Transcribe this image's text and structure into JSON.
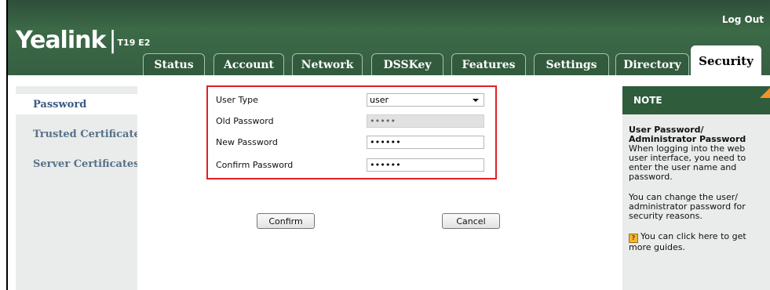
{
  "header": {
    "brand": "Yealink",
    "model": "T19 E2",
    "logout_label": "Log Out"
  },
  "tabs": [
    {
      "label": "Status"
    },
    {
      "label": "Account"
    },
    {
      "label": "Network"
    },
    {
      "label": "DSSKey"
    },
    {
      "label": "Features"
    },
    {
      "label": "Settings"
    },
    {
      "label": "Directory"
    },
    {
      "label": "Security",
      "active": true
    }
  ],
  "sidebar": {
    "items": [
      {
        "label": "Password",
        "active": true
      },
      {
        "label": "Trusted Certificates"
      },
      {
        "label": "Server Certificates"
      }
    ]
  },
  "form": {
    "user_type": {
      "label": "User Type",
      "value": "user"
    },
    "old_password": {
      "label": "Old Password",
      "value": "•••••"
    },
    "new_password": {
      "label": "New Password",
      "value": "••••••"
    },
    "confirm_password": {
      "label": "Confirm Password",
      "value": "••••••"
    },
    "confirm_label": "Confirm",
    "cancel_label": "Cancel"
  },
  "note": {
    "title": "NOTE",
    "heading": "User Password/ Administrator Password",
    "text1": "When logging into the web user interface, you need to enter the user name and password.",
    "text2": "You can change the user/ administrator password for security reasons.",
    "help_text": "You can click here to get more guides."
  },
  "colors": {
    "header_green": "#355f42",
    "highlight_red": "#e21f25",
    "note_corner": "#f3922a"
  }
}
